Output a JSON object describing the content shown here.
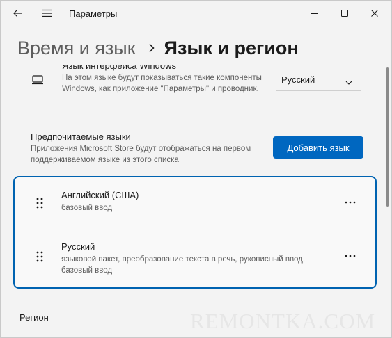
{
  "window": {
    "app_title": "Параметры"
  },
  "breadcrumb": {
    "parent": "Время и язык",
    "current": "Язык и регион"
  },
  "interface_language": {
    "title": "Язык интерфейса Windows",
    "description": "На этом языке будут показываться такие компоненты Windows, как приложение \"Параметры\" и проводник.",
    "selected_value": "Русский"
  },
  "preferred_languages": {
    "title": "Предпочитаемые языки",
    "description": "Приложения Microsoft Store будут отображаться на первом поддерживаемом языке из этого списка",
    "add_button_label": "Добавить язык",
    "items": [
      {
        "name": "Английский (США)",
        "features": "базовый ввод"
      },
      {
        "name": "Русский",
        "features": "языковой пакет, преобразование текста в речь, рукописный ввод, базовый ввод"
      }
    ]
  },
  "region": {
    "title": "Регион"
  },
  "watermark": "REMONTKA.COM",
  "colors": {
    "accent": "#0067c0",
    "focus_border": "#0063b1",
    "background": "#f3f3f3"
  }
}
